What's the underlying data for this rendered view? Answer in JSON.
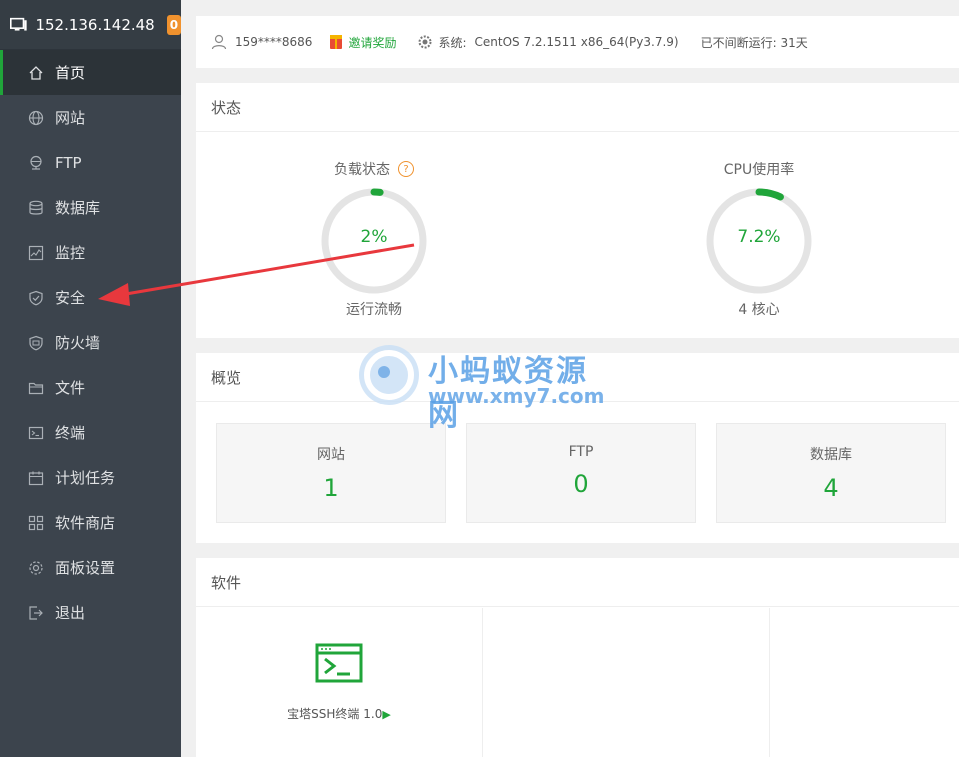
{
  "sidebar": {
    "ip": "152.136.142.48",
    "badge": "0",
    "items": [
      {
        "label": "首页",
        "icon": "home-icon"
      },
      {
        "label": "网站",
        "icon": "globe-icon"
      },
      {
        "label": "FTP",
        "icon": "ftp-icon"
      },
      {
        "label": "数据库",
        "icon": "database-icon"
      },
      {
        "label": "监控",
        "icon": "monitor-chart-icon"
      },
      {
        "label": "安全",
        "icon": "shield-icon"
      },
      {
        "label": "防火墙",
        "icon": "firewall-icon"
      },
      {
        "label": "文件",
        "icon": "folder-icon"
      },
      {
        "label": "终端",
        "icon": "terminal-icon"
      },
      {
        "label": "计划任务",
        "icon": "calendar-icon"
      },
      {
        "label": "软件商店",
        "icon": "apps-icon"
      },
      {
        "label": "面板设置",
        "icon": "gear-icon"
      },
      {
        "label": "退出",
        "icon": "logout-icon"
      }
    ]
  },
  "topbar": {
    "user": "159****8686",
    "invite": "邀请奖励",
    "system_label": "系统:",
    "system_value": "CentOS 7.2.1511 x86_64(Py3.7.9)",
    "uptime": "已不间断运行: 31天"
  },
  "status": {
    "title": "状态",
    "load": {
      "label": "负载状态",
      "value": "2%",
      "percent": 2,
      "sub": "运行流畅"
    },
    "cpu": {
      "label": "CPU使用率",
      "value": "7.2%",
      "percent": 7.2,
      "sub": "4 核心"
    }
  },
  "overview": {
    "title": "概览",
    "boxes": [
      {
        "label": "网站",
        "value": "1"
      },
      {
        "label": "FTP",
        "value": "0"
      },
      {
        "label": "数据库",
        "value": "4"
      }
    ]
  },
  "software": {
    "title": "软件",
    "items": [
      {
        "name": "宝塔SSH终端 1.0",
        "icon": "terminal-app-icon"
      }
    ]
  },
  "watermark": {
    "text": "小蚂蚁资源网",
    "url": "www.xmy7.com"
  },
  "colors": {
    "accent": "#20a53a",
    "sidebar_bg": "#3c444d",
    "badge": "#f0922e",
    "arrow": "#e8383d"
  }
}
